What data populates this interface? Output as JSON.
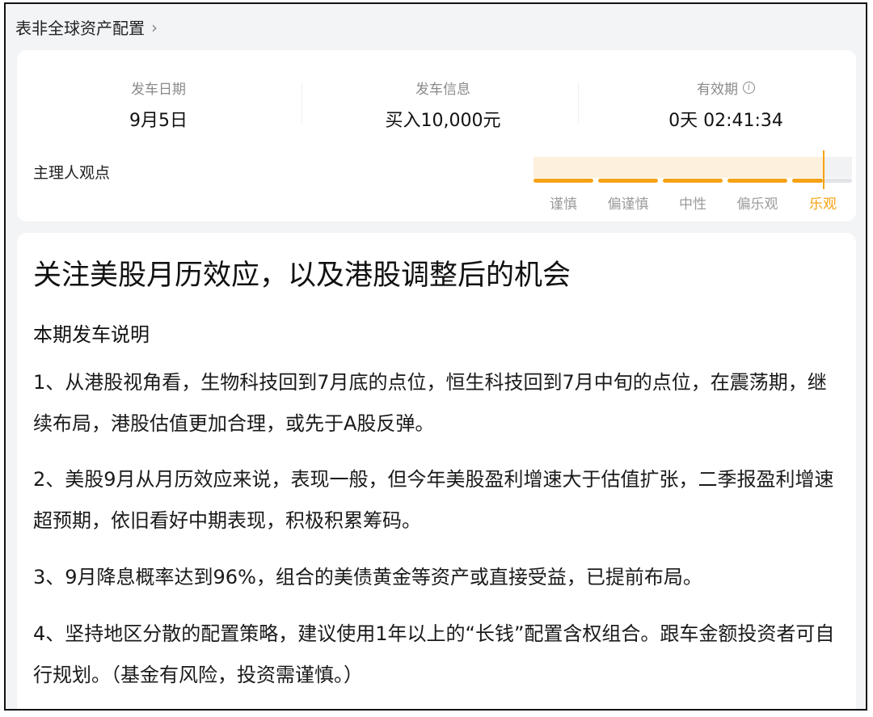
{
  "breadcrumb": {
    "title": "表非全球资产配置",
    "chevron": "chevron-right-icon"
  },
  "stats": [
    {
      "label": "发车日期",
      "value": "9月5日"
    },
    {
      "label": "发车信息",
      "value": "买入10,000元"
    },
    {
      "label": "有效期",
      "value": "0天 02:41:34",
      "icon": "info-icon"
    }
  ],
  "opinion": {
    "title": "主理人观点",
    "levels": [
      "谨慎",
      "偏谨慎",
      "中性",
      "偏乐观",
      "乐观"
    ],
    "selected_level": "乐观",
    "accent_color": "#f5a214"
  },
  "article": {
    "headline": "关注美股月历效应，以及港股调整后的机会",
    "section_title": "本期发车说明",
    "paragraphs": [
      "1、从港股视角看，生物科技回到7月底的点位，恒生科技回到7月中旬的点位，在震荡期，继续布局，港股估值更加合理，或先于A股反弹。",
      "2、美股9月从月历效应来说，表现一般，但今年美股盈利增速大于估值扩张，二季报盈利增速超预期，依旧看好中期表现，积极积累筹码。",
      "3、9月降息概率达到96%，组合的美债黄金等资产或直接受益，已提前布局。",
      "4、坚持地区分散的配置策略，建议使用1年以上的“长钱”配置含权组合。跟车金额投资者可自行规划。（基金有风险，投资需谨慎。）"
    ]
  }
}
